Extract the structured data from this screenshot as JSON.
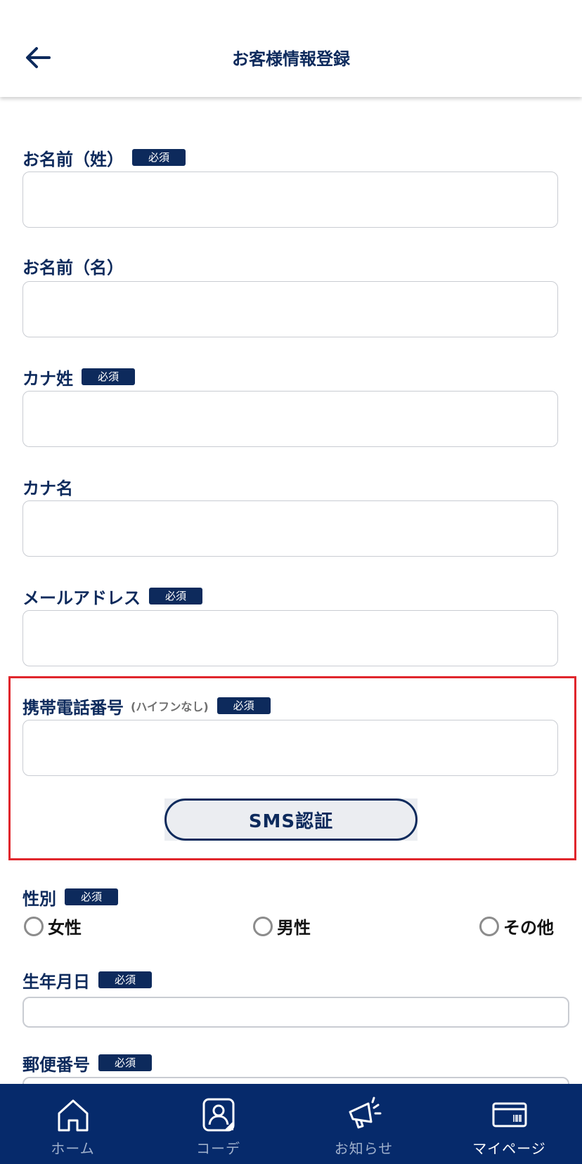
{
  "header": {
    "title": "お客様情報登録"
  },
  "form": {
    "last_name": {
      "label": "お名前（姓）",
      "required_badge": "必須",
      "value": ""
    },
    "first_name": {
      "label": "お名前（名）",
      "value": ""
    },
    "kana_last": {
      "label": "カナ姓",
      "required_badge": "必須",
      "value": ""
    },
    "kana_first": {
      "label": "カナ名",
      "value": ""
    },
    "email": {
      "label": "メールアドレス",
      "required_badge": "必須",
      "value": ""
    },
    "phone": {
      "label": "携帯電話番号",
      "note": "(ハイフンなし)",
      "required_badge": "必須",
      "value": ""
    },
    "sms_button": "SMS認証",
    "gender": {
      "label": "性別",
      "required_badge": "必須",
      "options": [
        "女性",
        "男性",
        "その他"
      ],
      "selected": null
    },
    "birthday": {
      "label": "生年月日",
      "required_badge": "必須"
    },
    "postal_code": {
      "label": "郵便番号",
      "required_badge": "必須"
    }
  },
  "bottom_nav": {
    "items": [
      {
        "label": "ホーム",
        "icon": "home-icon"
      },
      {
        "label": "コーデ",
        "icon": "coordinate-icon"
      },
      {
        "label": "お知らせ",
        "icon": "megaphone-icon"
      },
      {
        "label": "マイページ",
        "icon": "member-card-icon"
      }
    ],
    "active_index": 3
  },
  "colors": {
    "navy": "#0d2a5c",
    "nav_background": "#062a6b",
    "highlight_border": "#e0262c",
    "field_border": "#c9ccd2"
  }
}
